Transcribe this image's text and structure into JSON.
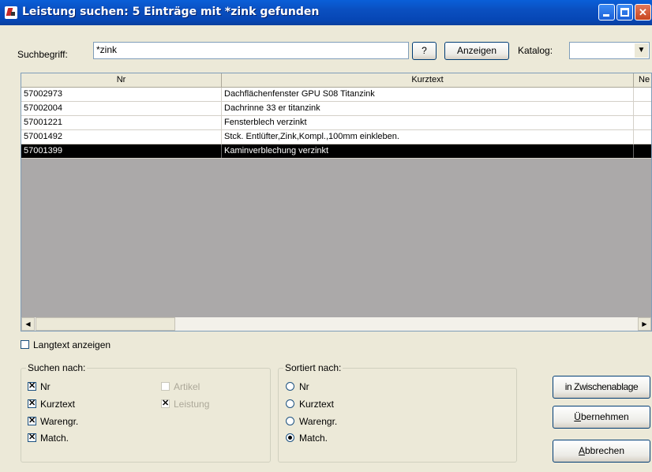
{
  "window": {
    "title": "Leistung suchen: 5 Einträge mit *zink gefunden"
  },
  "search": {
    "label": "Suchbegriff:",
    "value": "*zink",
    "help_label": "?",
    "show_label": "Anzeigen",
    "catalog_label": "Katalog:",
    "catalog_value": ""
  },
  "table": {
    "columns": [
      "Nr",
      "Kurztext",
      "Ne"
    ],
    "rows": [
      {
        "nr": "57002973",
        "kurztext": "Dachflächenfenster GPU S08 Titanzink",
        "selected": false
      },
      {
        "nr": "57002004",
        "kurztext": "Dachrinne 33 er titanzink",
        "selected": false
      },
      {
        "nr": "57001221",
        "kurztext": "Fensterblech verzinkt",
        "selected": false
      },
      {
        "nr": "57001492",
        "kurztext": "Stck. Entlüfter,Zink,Kompl.,100mm einkleben.",
        "selected": false
      },
      {
        "nr": "57001399",
        "kurztext": "Kaminverblechung verzinkt",
        "selected": true
      }
    ]
  },
  "langtext": {
    "label": "Langtext anzeigen",
    "checked": false
  },
  "suchen_nach": {
    "legend": "Suchen nach:",
    "options": [
      {
        "label": "Nr",
        "checked": true,
        "enabled": true
      },
      {
        "label": "Kurztext",
        "checked": true,
        "enabled": true
      },
      {
        "label": "Warengr.",
        "checked": true,
        "enabled": true
      },
      {
        "label": "Match.",
        "checked": true,
        "enabled": true
      },
      {
        "label": "Artikel",
        "checked": false,
        "enabled": false
      },
      {
        "label": "Leistung",
        "checked": true,
        "enabled": false
      }
    ]
  },
  "sortiert_nach": {
    "legend": "Sortiert nach:",
    "options": [
      {
        "label": "Nr",
        "selected": false
      },
      {
        "label": "Kurztext",
        "selected": false
      },
      {
        "label": "Warengr.",
        "selected": false
      },
      {
        "label": "Match.",
        "selected": true
      }
    ]
  },
  "buttons": {
    "clipboard": "in Zwischenablage",
    "accept_prefix": "Ü",
    "accept_rest": "bernehmen",
    "cancel_prefix": "A",
    "cancel_rest": "bbrechen"
  },
  "colors": {
    "titlebar": "#0a4fc0",
    "selection": "#000000",
    "list_background": "#aba9a9",
    "dialog": "#ece9d8"
  }
}
